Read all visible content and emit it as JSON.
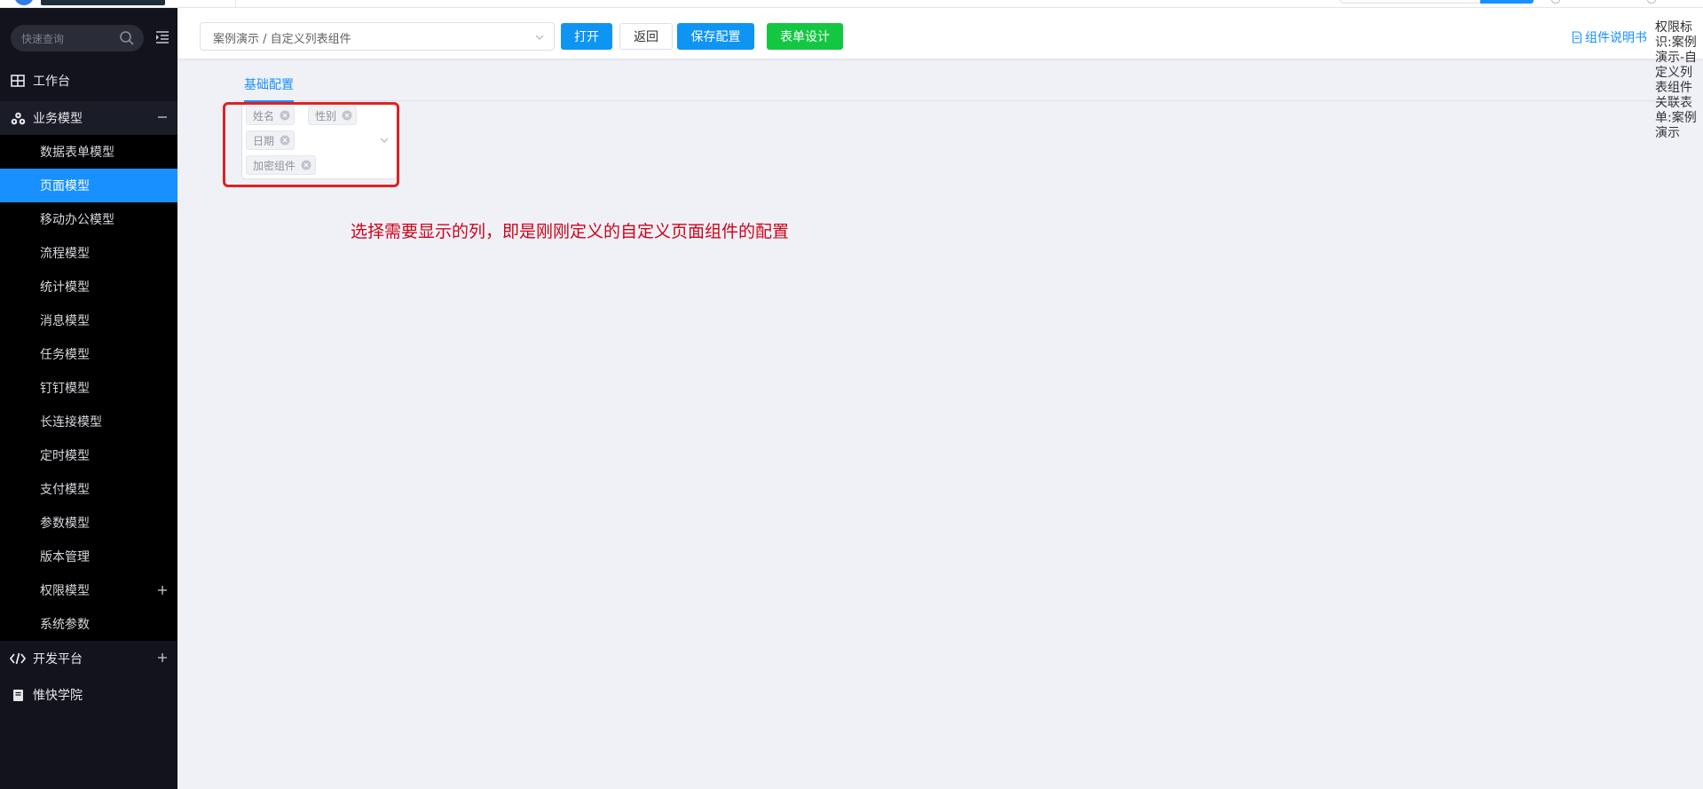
{
  "sidebar": {
    "search_placeholder": "快速查询",
    "items": [
      {
        "label": "工作台",
        "icon": "table-icon"
      },
      {
        "label": "业务模型",
        "icon": "cubes-icon",
        "expanded": true
      },
      {
        "label": "开发平台",
        "icon": "code-icon",
        "expanded": false
      },
      {
        "label": "惟快学院",
        "icon": "book-icon"
      }
    ],
    "sub_items": [
      {
        "label": "数据表单模型"
      },
      {
        "label": "页面模型",
        "active": true
      },
      {
        "label": "移动办公模型"
      },
      {
        "label": "流程模型"
      },
      {
        "label": "统计模型"
      },
      {
        "label": "消息模型"
      },
      {
        "label": "任务模型"
      },
      {
        "label": "钉钉模型"
      },
      {
        "label": "长连接模型"
      },
      {
        "label": "定时模型"
      },
      {
        "label": "支付模型"
      },
      {
        "label": "参数模型"
      },
      {
        "label": "版本管理"
      },
      {
        "label": "权限模型"
      },
      {
        "label": "系统参数"
      }
    ]
  },
  "toolbar": {
    "path_value": "案例演示 / 自定义列表组件",
    "open_label": "打开",
    "back_label": "返回",
    "save_label": "保存配置",
    "design_label": "表单设计",
    "doc_link_label": "组件说明书",
    "perm_label": "权限标识:",
    "perm_value": "案例演示-自定义列表组件",
    "related_label": "关联表单:",
    "related_value": "案例演示"
  },
  "main": {
    "tab_label": "基础配置",
    "selected_columns": [
      "姓名",
      "性别",
      "日期",
      "加密组件"
    ],
    "annotation": "选择需要显示的列，即是刚刚定义的自定义页面组件的配置"
  },
  "colors": {
    "sidebar_bg": "#12131c",
    "active_item": "#1890ff",
    "btn_blue": "#0e95f4",
    "btn_green": "#13c742",
    "highlight": "#e02020",
    "annotation": "#d0021b"
  }
}
